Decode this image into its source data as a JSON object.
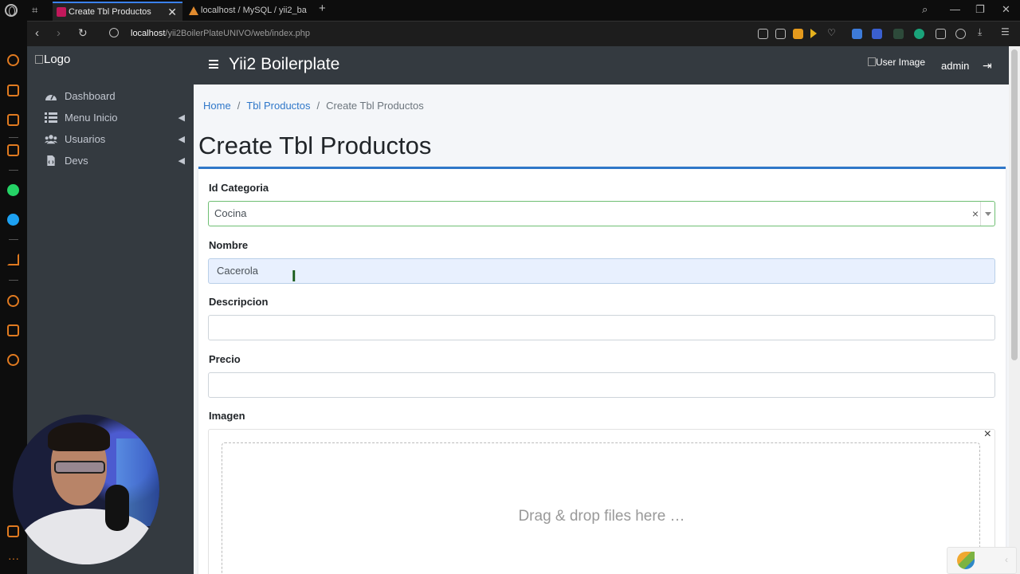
{
  "browser": {
    "tabs": [
      {
        "title": "Create Tbl Productos",
        "active": true
      },
      {
        "title": "localhost / MySQL / yii2_ba",
        "active": false
      }
    ],
    "address": {
      "host": "localhost",
      "path": "/yii2BoilerPlateUNIVO/web/index.php"
    },
    "accent": "#3b82f6"
  },
  "sidebar": {
    "logo_alt": "Logo",
    "items": [
      {
        "label": "Dashboard",
        "icon": "tachometer-icon",
        "has_children": false
      },
      {
        "label": "Menu Inicio",
        "icon": "list-icon",
        "has_children": true
      },
      {
        "label": "Usuarios",
        "icon": "users-icon",
        "has_children": true
      },
      {
        "label": "Devs",
        "icon": "code-file-icon",
        "has_children": true
      }
    ],
    "background": "#343a40"
  },
  "navbar": {
    "title": "Yii2 Boilerplate",
    "user_image_alt": "User Image",
    "user_name": "admin"
  },
  "breadcrumb": {
    "home": "Home",
    "section": "Tbl Productos",
    "current": "Create Tbl Productos"
  },
  "page": {
    "title": "Create Tbl Productos",
    "primary_color": "#2f77c9"
  },
  "form": {
    "id_categoria": {
      "label": "Id Categoria",
      "value": "Cocina"
    },
    "nombre": {
      "label": "Nombre",
      "value": "Cacerola"
    },
    "descripcion": {
      "label": "Descripcion",
      "value": ""
    },
    "precio": {
      "label": "Precio",
      "value": ""
    },
    "imagen": {
      "label": "Imagen",
      "drop_text": "Drag & drop files here …"
    }
  }
}
